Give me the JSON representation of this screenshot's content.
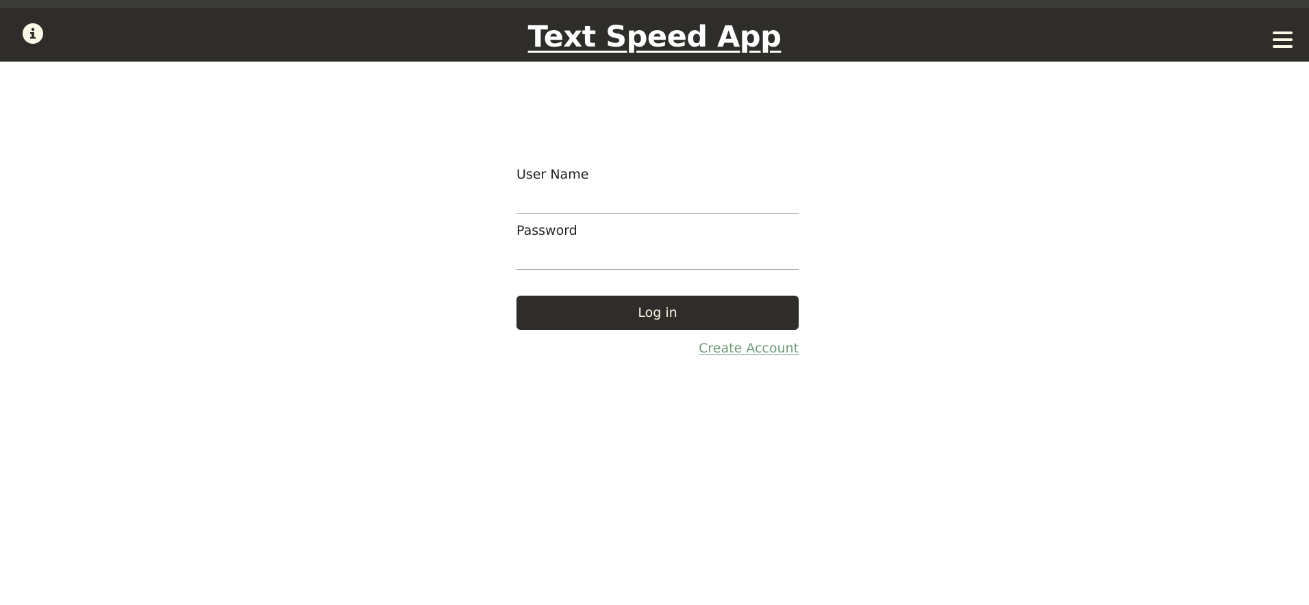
{
  "header": {
    "title": "Text Speed App",
    "info_icon": "info-circle-icon",
    "menu_icon": "hamburger-menu-icon",
    "background_color": "#2e2d29",
    "icon_color": "#fbf8e6"
  },
  "login_form": {
    "username_label": "User Name",
    "username_value": "",
    "password_label": "Password",
    "password_value": "",
    "login_button_label": "Log in",
    "create_account_link": "Create Account",
    "link_color": "#6e9b78"
  }
}
